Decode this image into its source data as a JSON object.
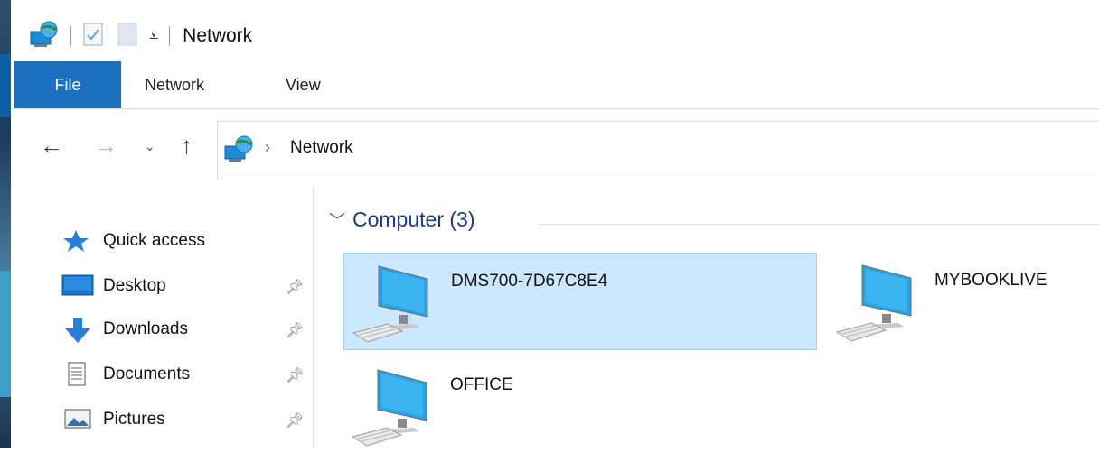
{
  "window": {
    "title": "Network"
  },
  "ribbon": {
    "tabs": [
      "File",
      "Network",
      "View"
    ]
  },
  "address": {
    "path": "Network",
    "separator": "›"
  },
  "nav_buttons": {
    "back": "←",
    "forward": "→",
    "recent": "⌄",
    "up": "↑"
  },
  "sidebar": {
    "items": [
      {
        "label": "Quick access",
        "icon": "star-icon"
      },
      {
        "label": "Desktop",
        "icon": "desktop-icon",
        "pinned": true
      },
      {
        "label": "Downloads",
        "icon": "download-arrow-icon",
        "pinned": true
      },
      {
        "label": "Documents",
        "icon": "document-icon",
        "pinned": true
      },
      {
        "label": "Pictures",
        "icon": "pictures-icon",
        "pinned": true
      }
    ]
  },
  "content": {
    "group_title": "Computer (3)",
    "computers": [
      {
        "name": "DMS700-7D67C8E4",
        "selected": true
      },
      {
        "name": "MYBOOKLIVE",
        "selected": false
      },
      {
        "name": "OFFICE",
        "selected": false
      }
    ]
  },
  "colors": {
    "accent": "#1a6fc0",
    "selection": "#cce8ff",
    "group_header": "#1e3a8a"
  }
}
